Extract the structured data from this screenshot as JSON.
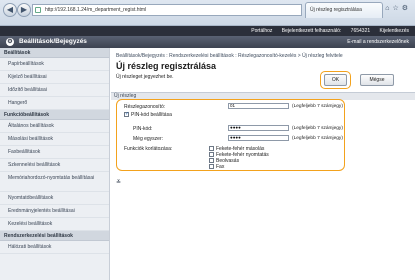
{
  "browser": {
    "url": "http://192.168.1.24/m_department_regist.html",
    "tab_title": "Új részleg regisztrálása",
    "back": "◀",
    "forward": "▶",
    "window_icons": "⌂☆⚙"
  },
  "appbar": {
    "portal": "Portálhoz",
    "user_label": "Bejelentkezett felhasználó:",
    "user_id": "7654321",
    "logout": "Kijelentkezés"
  },
  "titlebar": {
    "title": "Beállítások/Bejegyzés",
    "email_link": "E-mail a rendszerkezelőnek"
  },
  "sidebar": {
    "section1": "Beállítások",
    "items1": [
      "Papírbeállítások",
      "Kijelző beállításai",
      "Időzítő beállításai",
      "Hangerő"
    ],
    "section2": "Funkcióbeállítások",
    "items2": [
      "Általános beállítások",
      "Másolási beállítások",
      "Faxbeállítások",
      "Szkennelési beállítások",
      "Memóriahordozó-nyomtatás beállításai",
      "Nyomtatóbeállítások",
      "Erednmányjelentés beállításai",
      "Kezelési beállítások"
    ],
    "section3": "Rendszerkezelési beállítások",
    "items3": [
      "Hálózati beállítások"
    ]
  },
  "main": {
    "breadcrumb": "Beállítások/Bejegyzés : Rendszerkezelési beállítások : Részlegazonosító-kezelés > Új részleg felvitele",
    "title": "Új részleg regisztrálása",
    "desc": "Új részleget jegyezhet be.",
    "ok_label": "OK",
    "cancel_label": "Mégse",
    "section_label": "Új részleg",
    "dept_id_label": "Részlegazonosító:",
    "dept_id_value": "01",
    "dept_id_hint": "(Legfeljebb 7 számjegy)",
    "pin_setting_label": "PIN-kód beállítása",
    "pin_label": "PIN-kód:",
    "pin_value": "●●●●",
    "pin_hint": "(Legfeljebb 7 számjegy)",
    "confirm_label": "Még egyszer:",
    "confirm_value": "●●●●",
    "confirm_hint": "(Legfeljebb 7 számjegy)",
    "restrict_label": "Funkciók korlátozása:",
    "restrict_options": [
      "Fekete-fehér másolás",
      "Fekete-fehér nyomtatás",
      "Beolvasás",
      "Fax"
    ],
    "collapse_icon": "≚"
  },
  "colors": {
    "highlight": "#f3a21d",
    "header": "#3c4250"
  }
}
